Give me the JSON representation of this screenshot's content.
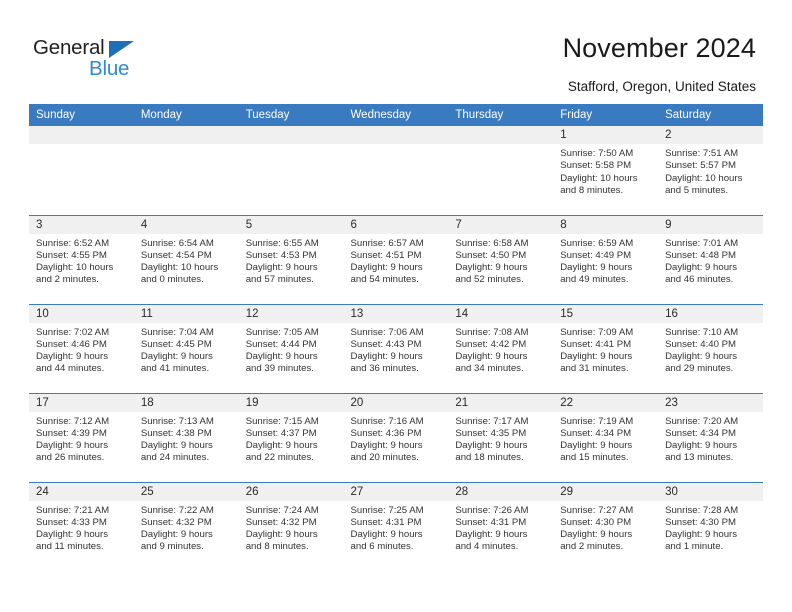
{
  "brand": {
    "name_part1": "General",
    "name_part2": "Blue",
    "accent_color": "#2e8ad4",
    "triangle_color": "#1b70b8"
  },
  "header": {
    "title": "November 2024",
    "subtitle": "Stafford, Oregon, United States",
    "header_bg": "#3a7ac0",
    "daynum_bg": "#f0f0f0"
  },
  "calendar": {
    "weekday_headers": [
      "Sunday",
      "Monday",
      "Tuesday",
      "Wednesday",
      "Thursday",
      "Friday",
      "Saturday"
    ],
    "weeks": [
      [
        {
          "day": "",
          "info": ""
        },
        {
          "day": "",
          "info": ""
        },
        {
          "day": "",
          "info": ""
        },
        {
          "day": "",
          "info": ""
        },
        {
          "day": "",
          "info": ""
        },
        {
          "day": "1",
          "info": "Sunrise: 7:50 AM\nSunset: 5:58 PM\nDaylight: 10 hours\nand 8 minutes."
        },
        {
          "day": "2",
          "info": "Sunrise: 7:51 AM\nSunset: 5:57 PM\nDaylight: 10 hours\nand 5 minutes."
        }
      ],
      [
        {
          "day": "3",
          "info": "Sunrise: 6:52 AM\nSunset: 4:55 PM\nDaylight: 10 hours\nand 2 minutes."
        },
        {
          "day": "4",
          "info": "Sunrise: 6:54 AM\nSunset: 4:54 PM\nDaylight: 10 hours\nand 0 minutes."
        },
        {
          "day": "5",
          "info": "Sunrise: 6:55 AM\nSunset: 4:53 PM\nDaylight: 9 hours\nand 57 minutes."
        },
        {
          "day": "6",
          "info": "Sunrise: 6:57 AM\nSunset: 4:51 PM\nDaylight: 9 hours\nand 54 minutes."
        },
        {
          "day": "7",
          "info": "Sunrise: 6:58 AM\nSunset: 4:50 PM\nDaylight: 9 hours\nand 52 minutes."
        },
        {
          "day": "8",
          "info": "Sunrise: 6:59 AM\nSunset: 4:49 PM\nDaylight: 9 hours\nand 49 minutes."
        },
        {
          "day": "9",
          "info": "Sunrise: 7:01 AM\nSunset: 4:48 PM\nDaylight: 9 hours\nand 46 minutes."
        }
      ],
      [
        {
          "day": "10",
          "info": "Sunrise: 7:02 AM\nSunset: 4:46 PM\nDaylight: 9 hours\nand 44 minutes."
        },
        {
          "day": "11",
          "info": "Sunrise: 7:04 AM\nSunset: 4:45 PM\nDaylight: 9 hours\nand 41 minutes."
        },
        {
          "day": "12",
          "info": "Sunrise: 7:05 AM\nSunset: 4:44 PM\nDaylight: 9 hours\nand 39 minutes."
        },
        {
          "day": "13",
          "info": "Sunrise: 7:06 AM\nSunset: 4:43 PM\nDaylight: 9 hours\nand 36 minutes."
        },
        {
          "day": "14",
          "info": "Sunrise: 7:08 AM\nSunset: 4:42 PM\nDaylight: 9 hours\nand 34 minutes."
        },
        {
          "day": "15",
          "info": "Sunrise: 7:09 AM\nSunset: 4:41 PM\nDaylight: 9 hours\nand 31 minutes."
        },
        {
          "day": "16",
          "info": "Sunrise: 7:10 AM\nSunset: 4:40 PM\nDaylight: 9 hours\nand 29 minutes."
        }
      ],
      [
        {
          "day": "17",
          "info": "Sunrise: 7:12 AM\nSunset: 4:39 PM\nDaylight: 9 hours\nand 26 minutes."
        },
        {
          "day": "18",
          "info": "Sunrise: 7:13 AM\nSunset: 4:38 PM\nDaylight: 9 hours\nand 24 minutes."
        },
        {
          "day": "19",
          "info": "Sunrise: 7:15 AM\nSunset: 4:37 PM\nDaylight: 9 hours\nand 22 minutes."
        },
        {
          "day": "20",
          "info": "Sunrise: 7:16 AM\nSunset: 4:36 PM\nDaylight: 9 hours\nand 20 minutes."
        },
        {
          "day": "21",
          "info": "Sunrise: 7:17 AM\nSunset: 4:35 PM\nDaylight: 9 hours\nand 18 minutes."
        },
        {
          "day": "22",
          "info": "Sunrise: 7:19 AM\nSunset: 4:34 PM\nDaylight: 9 hours\nand 15 minutes."
        },
        {
          "day": "23",
          "info": "Sunrise: 7:20 AM\nSunset: 4:34 PM\nDaylight: 9 hours\nand 13 minutes."
        }
      ],
      [
        {
          "day": "24",
          "info": "Sunrise: 7:21 AM\nSunset: 4:33 PM\nDaylight: 9 hours\nand 11 minutes."
        },
        {
          "day": "25",
          "info": "Sunrise: 7:22 AM\nSunset: 4:32 PM\nDaylight: 9 hours\nand 9 minutes."
        },
        {
          "day": "26",
          "info": "Sunrise: 7:24 AM\nSunset: 4:32 PM\nDaylight: 9 hours\nand 8 minutes."
        },
        {
          "day": "27",
          "info": "Sunrise: 7:25 AM\nSunset: 4:31 PM\nDaylight: 9 hours\nand 6 minutes."
        },
        {
          "day": "28",
          "info": "Sunrise: 7:26 AM\nSunset: 4:31 PM\nDaylight: 9 hours\nand 4 minutes."
        },
        {
          "day": "29",
          "info": "Sunrise: 7:27 AM\nSunset: 4:30 PM\nDaylight: 9 hours\nand 2 minutes."
        },
        {
          "day": "30",
          "info": "Sunrise: 7:28 AM\nSunset: 4:30 PM\nDaylight: 9 hours\nand 1 minute."
        }
      ]
    ]
  }
}
